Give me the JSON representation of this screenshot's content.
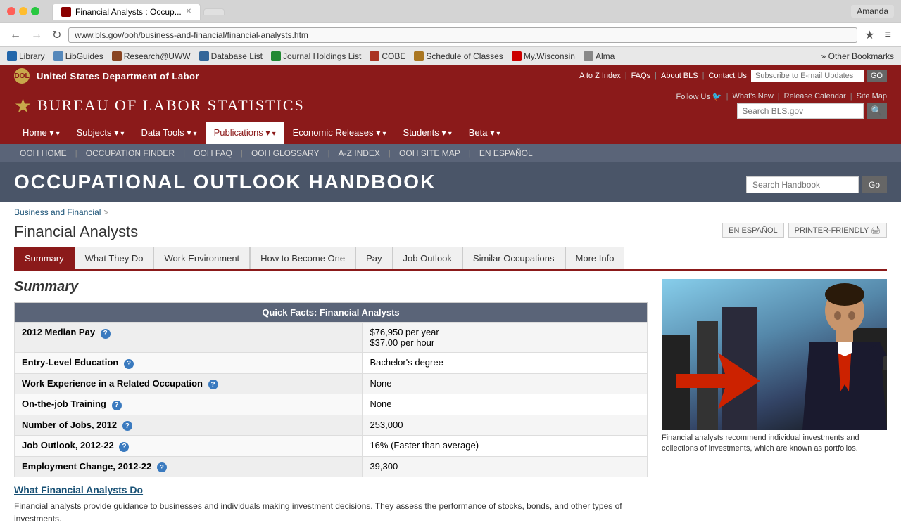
{
  "browser": {
    "title_bar": {
      "tab_label": "Financial Analysts : Occup...",
      "user_name": "Amanda"
    },
    "address_bar": {
      "url": "www.bls.gov/ooh/business-and-financial/financial-analysts.htm"
    },
    "bookmarks": [
      {
        "label": "Library",
        "icon": "lib"
      },
      {
        "label": "LibGuides",
        "icon": "libguides"
      },
      {
        "label": "Research@UWW",
        "icon": "research"
      },
      {
        "label": "Database List",
        "icon": "db"
      },
      {
        "label": "Journal Holdings List",
        "icon": "journals"
      },
      {
        "label": "COBE",
        "icon": "cobe"
      },
      {
        "label": "Schedule of Classes",
        "icon": "schedule"
      },
      {
        "label": "My.Wisconsin",
        "icon": "wisconsin"
      },
      {
        "label": "Alma",
        "icon": "alma"
      },
      {
        "label": "Other Bookmarks",
        "icon": "other"
      }
    ]
  },
  "bls": {
    "department": "United States Department of Labor",
    "logo_text": "DOL",
    "bureau_title": "Bureau of Labor Statistics",
    "top_links": [
      "A to Z Index",
      "FAQs",
      "About BLS",
      "Contact Us"
    ],
    "subscribe_placeholder": "Subscribe to E-mail Updates",
    "go_label": "GO",
    "follow_links": [
      "Follow Us",
      "What's New",
      "Release Calendar",
      "Site Map"
    ],
    "search_placeholder": "Search BLS.gov",
    "nav_items": [
      "Home",
      "Subjects",
      "Data Tools",
      "Publications",
      "Economic Releases",
      "Students",
      "Beta"
    ]
  },
  "ooh": {
    "title": "Occupational Outlook Handbook",
    "nav_links": [
      "OOH HOME",
      "OCCUPATION FINDER",
      "OOH FAQ",
      "OOH GLOSSARY",
      "A-Z INDEX",
      "OOH SITE MAP",
      "EN ESPAÑOL"
    ],
    "search_placeholder": "Search Handbook",
    "go_label": "Go"
  },
  "page": {
    "breadcrumb": "Business and Financial >",
    "breadcrumb_link": "Business and Financial",
    "title": "Financial Analysts",
    "action_links": [
      "EN ESPAÑOL",
      "PRINTER-FRIENDLY"
    ],
    "tabs": [
      {
        "label": "Summary",
        "active": true
      },
      {
        "label": "What They Do",
        "active": false
      },
      {
        "label": "Work Environment",
        "active": false
      },
      {
        "label": "How to Become One",
        "active": false
      },
      {
        "label": "Pay",
        "active": false
      },
      {
        "label": "Job Outlook",
        "active": false
      },
      {
        "label": "Similar Occupations",
        "active": false
      },
      {
        "label": "More Info",
        "active": false
      }
    ]
  },
  "summary": {
    "heading": "Summary",
    "quick_facts_title": "Quick Facts: Financial Analysts",
    "rows": [
      {
        "label": "2012 Median Pay",
        "value": "$76,950 per year\n$37.00 per hour",
        "value_line1": "$76,950 per year",
        "value_line2": "$37.00 per hour",
        "has_info": true
      },
      {
        "label": "Entry-Level Education",
        "value": "Bachelor's degree",
        "has_info": true
      },
      {
        "label": "Work Experience in a Related Occupation",
        "value": "None",
        "has_info": true
      },
      {
        "label": "On-the-job Training",
        "value": "None",
        "has_info": true
      },
      {
        "label": "Number of Jobs, 2012",
        "value": "253,000",
        "has_info": true
      },
      {
        "label": "Job Outlook, 2012-22",
        "value": "16% (Faster than average)",
        "has_info": true
      },
      {
        "label": "Employment Change, 2012-22",
        "value": "39,300",
        "has_info": true
      }
    ],
    "what_they_do_link": "What Financial Analysts Do",
    "description": "Financial analysts provide guidance to businesses and individuals making investment decisions. They assess the performance of stocks, bonds, and other types of investments.",
    "image_caption": "Financial analysts recommend individual investments and collections of investments, which are known as portfolios."
  }
}
